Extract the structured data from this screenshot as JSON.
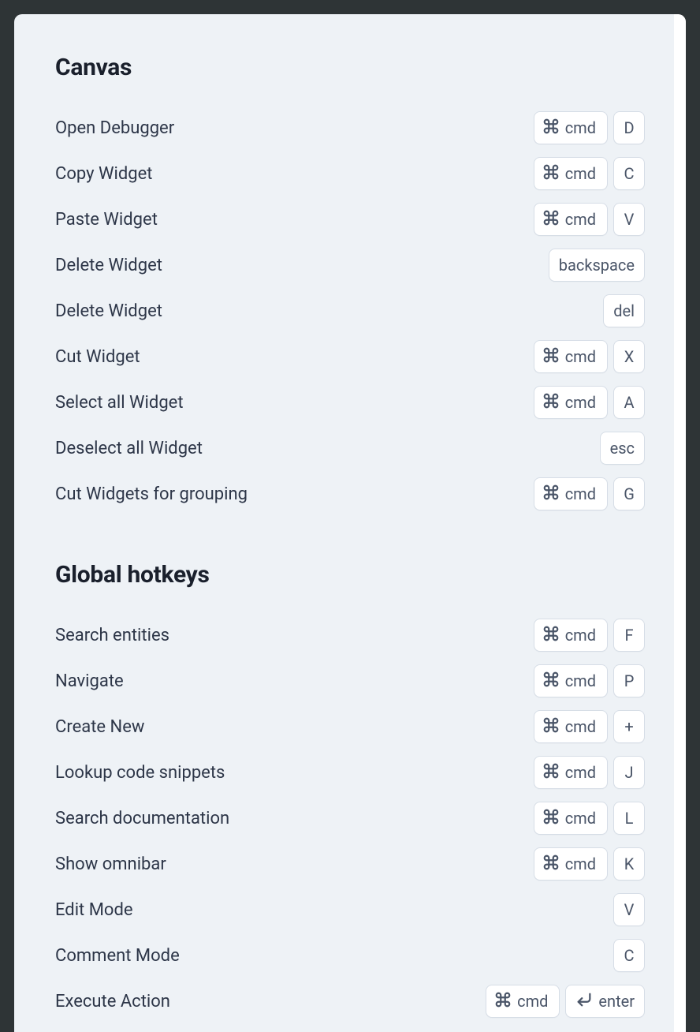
{
  "modifier_labels": {
    "cmd": "cmd",
    "enter": "enter"
  },
  "sections": [
    {
      "title": "Canvas",
      "items": [
        {
          "label": "Open Debugger",
          "keys": [
            {
              "type": "cmd"
            },
            {
              "type": "text",
              "text": "D"
            }
          ]
        },
        {
          "label": "Copy Widget",
          "keys": [
            {
              "type": "cmd"
            },
            {
              "type": "text",
              "text": "C"
            }
          ]
        },
        {
          "label": "Paste Widget",
          "keys": [
            {
              "type": "cmd"
            },
            {
              "type": "text",
              "text": "V"
            }
          ]
        },
        {
          "label": "Delete Widget",
          "keys": [
            {
              "type": "text",
              "text": "backspace"
            }
          ]
        },
        {
          "label": "Delete Widget",
          "keys": [
            {
              "type": "text",
              "text": "del"
            }
          ]
        },
        {
          "label": "Cut Widget",
          "keys": [
            {
              "type": "cmd"
            },
            {
              "type": "text",
              "text": "X"
            }
          ]
        },
        {
          "label": "Select all Widget",
          "keys": [
            {
              "type": "cmd"
            },
            {
              "type": "text",
              "text": "A"
            }
          ]
        },
        {
          "label": "Deselect all Widget",
          "keys": [
            {
              "type": "text",
              "text": "esc"
            }
          ]
        },
        {
          "label": "Cut Widgets for grouping",
          "keys": [
            {
              "type": "cmd"
            },
            {
              "type": "text",
              "text": "G"
            }
          ]
        }
      ]
    },
    {
      "title": "Global hotkeys",
      "items": [
        {
          "label": "Search entities",
          "keys": [
            {
              "type": "cmd"
            },
            {
              "type": "text",
              "text": "F"
            }
          ]
        },
        {
          "label": "Navigate",
          "keys": [
            {
              "type": "cmd"
            },
            {
              "type": "text",
              "text": "P"
            }
          ]
        },
        {
          "label": "Create New",
          "keys": [
            {
              "type": "cmd"
            },
            {
              "type": "text",
              "text": "+"
            }
          ]
        },
        {
          "label": "Lookup code snippets",
          "keys": [
            {
              "type": "cmd"
            },
            {
              "type": "text",
              "text": "J"
            }
          ]
        },
        {
          "label": "Search documentation",
          "keys": [
            {
              "type": "cmd"
            },
            {
              "type": "text",
              "text": "L"
            }
          ]
        },
        {
          "label": "Show omnibar",
          "keys": [
            {
              "type": "cmd"
            },
            {
              "type": "text",
              "text": "K"
            }
          ]
        },
        {
          "label": "Edit Mode",
          "keys": [
            {
              "type": "text",
              "text": "V"
            }
          ]
        },
        {
          "label": "Comment Mode",
          "keys": [
            {
              "type": "text",
              "text": "C"
            }
          ]
        },
        {
          "label": "Execute Action",
          "keys": [
            {
              "type": "cmd"
            },
            {
              "type": "enter"
            }
          ]
        }
      ]
    }
  ]
}
